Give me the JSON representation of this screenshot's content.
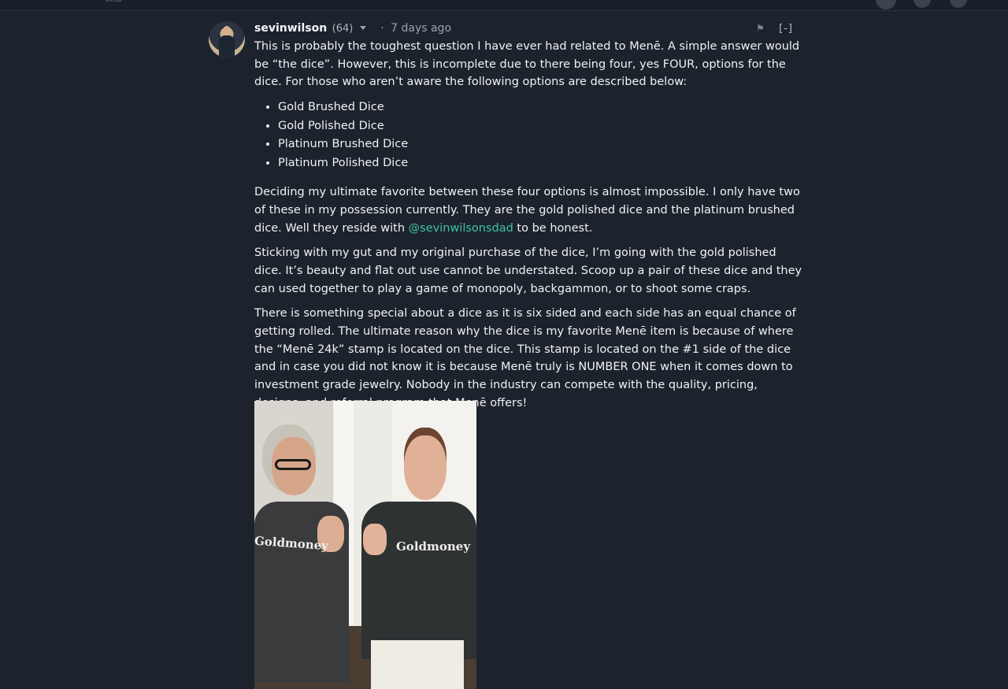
{
  "topbar": {
    "beta_label": "beta"
  },
  "comment": {
    "author": "sevinwilson",
    "reputation": "(64)",
    "separator": "·",
    "time_ago": "7 days ago",
    "collapse_label": "[-]",
    "intro": "This is probably the toughest question I have ever had related to Menē. A simple answer would be “the dice”. However, this is incomplete due to there being four, yes FOUR, options for the dice. For those who aren’t aware the following options are described below:",
    "options": [
      "Gold Brushed Dice",
      "Gold Polished Dice",
      "Platinum Brushed Dice",
      "Platinum Polished Dice"
    ],
    "paragraph2_before": "Deciding my ultimate favorite between these four options is almost impossible. I only have two of these in my possession currently. They are the gold polished dice and the platinum brushed dice. Well they reside with ",
    "mention": "@sevinwilsonsdad",
    "paragraph2_after": " to be honest.",
    "paragraph3": "Sticking with my gut and my original purchase of the dice, I’m going with the gold polished dice. It’s beauty and flat out use cannot be understated. Scoop up a pair of these dice and they can used together to play a game of monopoly, backgammon, or to shoot some craps.",
    "paragraph4": "There is something special about a dice as it is six sided and each side has an equal chance of getting rolled. The ultimate reason why the dice is my favorite Menē item is because of where the “Menē 24k” stamp is located on the dice. This stamp is located on the #1 side of the dice and in case you did not know it is because Menē truly is NUMBER ONE when it comes down to investment grade jewelry. Nobody in the industry can compete with the quality, pricing, designs, and referral program that Menē offers!",
    "photo_shirt_text_left": "Goldmoney",
    "photo_shirt_text_right": "Goldmoney"
  },
  "icons": {
    "avatar": "user-avatar",
    "dropdown": "chevron-down-icon",
    "flag": "flag-icon"
  }
}
